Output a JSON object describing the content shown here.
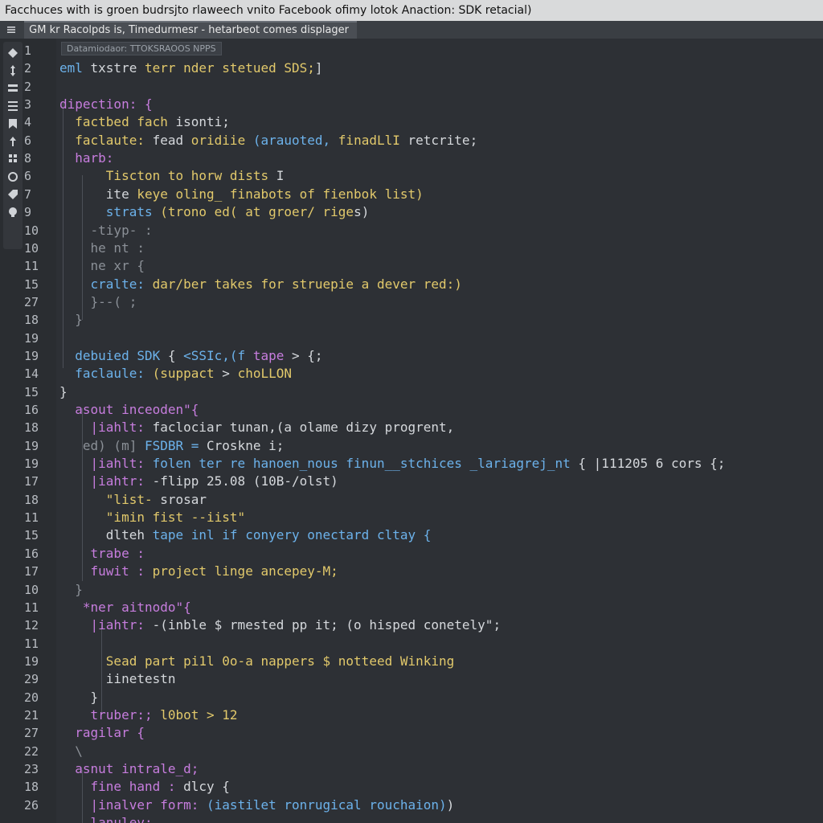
{
  "window": {
    "title": "Facchuces with is groen budrsjto rlaweech vnito Facebook ofimy lotok Anaction: SDK retacial)"
  },
  "tab": {
    "label": "GM kr Racolpds is, Timedurmesr - hetarbeot comes displager"
  },
  "tooltip": {
    "text": "Datamiodaor: TTOKSRAOOS NPPS"
  },
  "sidebar": {
    "tools": [
      "diamond-icon",
      "move-icon",
      "stack-icon",
      "bars-icon",
      "bookmark-icon",
      "arrow-icon",
      "grid-icon",
      "circle-icon",
      "tag-icon",
      "bulb-icon"
    ]
  },
  "colors": {
    "purple": "#c77dde",
    "blue": "#6cb2eb",
    "yellow": "#e2c96b",
    "green": "#b6d77a",
    "white": "#d5d8dc",
    "gray": "#8b9097",
    "background": "#2d3035"
  },
  "gutter": {
    "numbers": [
      "1",
      "2",
      "2",
      "3",
      "4",
      "6",
      "8",
      "6",
      "7",
      "9",
      "10",
      "10",
      "11",
      "15",
      "27",
      "18",
      "19",
      "19",
      "14",
      "15",
      "16",
      "18",
      "19",
      "19",
      "17",
      "18",
      "11",
      "15",
      "16",
      "17",
      "10",
      "11",
      "12",
      "11",
      "19",
      "29",
      "20",
      "21",
      "27",
      "22",
      "23",
      "18",
      "26"
    ]
  },
  "code": {
    "lines": [
      [
        {
          "t": "",
          "c": "white"
        }
      ],
      [
        {
          "t": "eml ",
          "c": "blue"
        },
        {
          "t": "txstre ",
          "c": "white"
        },
        {
          "t": "terr nder stetued SDS;",
          "c": "yellow"
        },
        {
          "t": "]",
          "c": "white"
        }
      ],
      [
        {
          "t": "",
          "c": "white"
        }
      ],
      [
        {
          "t": "dipection: {",
          "c": "purple"
        }
      ],
      [
        {
          "t": "  factbed fach ",
          "c": "yellow"
        },
        {
          "t": "isonti;",
          "c": "white"
        }
      ],
      [
        {
          "t": "  faclaute: ",
          "c": "yellow"
        },
        {
          "t": "fead ",
          "c": "white"
        },
        {
          "t": "oridiie ",
          "c": "yellow"
        },
        {
          "t": "(arauoted, ",
          "c": "blue"
        },
        {
          "t": "finadLlI ",
          "c": "yellow"
        },
        {
          "t": "retcrite;",
          "c": "white"
        }
      ],
      [
        {
          "t": "  harb:",
          "c": "purple"
        }
      ],
      [
        {
          "t": "      Tiscton to horw dists ",
          "c": "yellow"
        },
        {
          "t": "I",
          "c": "white"
        }
      ],
      [
        {
          "t": "      ite ",
          "c": "white"
        },
        {
          "t": "keye oling_ finabots of fienbok list)",
          "c": "yellow"
        }
      ],
      [
        {
          "t": "      strats ",
          "c": "blue"
        },
        {
          "t": "(trono ed( at groer/ rige",
          "c": "yellow"
        },
        {
          "t": "s)",
          "c": "white"
        }
      ],
      [
        {
          "t": "    -tiyp- :",
          "c": "gray"
        }
      ],
      [
        {
          "t": "    he nt :",
          "c": "gray"
        }
      ],
      [
        {
          "t": "    ne xr {",
          "c": "gray"
        }
      ],
      [
        {
          "t": "    cralte: ",
          "c": "blue"
        },
        {
          "t": "dar/ber takes for struepie a dever red:)",
          "c": "yellow"
        }
      ],
      [
        {
          "t": "    }--( ;",
          "c": "gray"
        }
      ],
      [
        {
          "t": "  }",
          "c": "gray"
        }
      ],
      [
        {
          "t": "",
          "c": "white"
        }
      ],
      [
        {
          "t": "  debuied SDK ",
          "c": "blue"
        },
        {
          "t": "{ ",
          "c": "white"
        },
        {
          "t": "<SSIc,(f ",
          "c": "blue"
        },
        {
          "t": "tape ",
          "c": "purple"
        },
        {
          "t": "> {;",
          "c": "white"
        }
      ],
      [
        {
          "t": "  faclaule: ",
          "c": "blue"
        },
        {
          "t": "(suppact ",
          "c": "yellow"
        },
        {
          "t": "> ",
          "c": "white"
        },
        {
          "t": "choLLON",
          "c": "yellow"
        }
      ],
      [
        {
          "t": "}",
          "c": "white"
        }
      ],
      [
        {
          "t": "  asout inceoden\"{",
          "c": "purple"
        }
      ],
      [
        {
          "t": "    |iahlt: ",
          "c": "purple"
        },
        {
          "t": "faclociar tunan,(a olame dizy progrent,",
          "c": "white"
        }
      ],
      [
        {
          "t": "   ed) (m] ",
          "c": "gray"
        },
        {
          "t": "FSDBR = ",
          "c": "blue"
        },
        {
          "t": "Croskne i;",
          "c": "white"
        }
      ],
      [
        {
          "t": "    |iahlt: ",
          "c": "purple"
        },
        {
          "t": "folen ter re hanoen_nous finun__stchices _lariagrej_nt ",
          "c": "blue"
        },
        {
          "t": "{ ",
          "c": "white"
        },
        {
          "t": "|111205 6 cors {;",
          "c": "white"
        }
      ],
      [
        {
          "t": "    |iahtr: ",
          "c": "purple"
        },
        {
          "t": "-flipp 25.08 (10B-/olst)",
          "c": "white"
        }
      ],
      [
        {
          "t": "      \"list- ",
          "c": "yellow"
        },
        {
          "t": "srosar",
          "c": "white"
        }
      ],
      [
        {
          "t": "      \"imin fist --iist\"",
          "c": "yellow"
        }
      ],
      [
        {
          "t": "      dlteh ",
          "c": "white"
        },
        {
          "t": "tape inl if conyery onectard cltay {",
          "c": "blue"
        }
      ],
      [
        {
          "t": "    trabe :",
          "c": "purple"
        }
      ],
      [
        {
          "t": "    fuwit : ",
          "c": "purple"
        },
        {
          "t": "project linge ancepey-M;",
          "c": "yellow"
        }
      ],
      [
        {
          "t": "  }",
          "c": "gray"
        }
      ],
      [
        {
          "t": "   *ner aitnodo\"{",
          "c": "purple"
        }
      ],
      [
        {
          "t": "    |iahtr: ",
          "c": "purple"
        },
        {
          "t": "-(inble $ rmested pp it; (o hisped conetely\";",
          "c": "white"
        }
      ],
      [
        {
          "t": "",
          "c": "white"
        }
      ],
      [
        {
          "t": "      Sead part pi1l 0o-a nappers $ notteed Winking",
          "c": "yellow"
        }
      ],
      [
        {
          "t": "      iinetestn",
          "c": "white"
        }
      ],
      [
        {
          "t": "    }",
          "c": "white"
        }
      ],
      [
        {
          "t": "    truber:; ",
          "c": "purple"
        },
        {
          "t": "l0bot > 12",
          "c": "yellow"
        }
      ],
      [
        {
          "t": "  ragilar {",
          "c": "purple"
        }
      ],
      [
        {
          "t": "  \\",
          "c": "gray"
        }
      ],
      [
        {
          "t": "  asnut intrale_d;",
          "c": "purple"
        }
      ],
      [
        {
          "t": "    fine hand : ",
          "c": "purple"
        },
        {
          "t": "dlcy {",
          "c": "white"
        }
      ],
      [
        {
          "t": "    |inalver form: ",
          "c": "purple"
        },
        {
          "t": "(iastilet ronrugical rouchaion)",
          "c": "blue"
        },
        {
          "t": ")",
          "c": "white"
        }
      ],
      [
        {
          "t": "    lanulev:",
          "c": "purple"
        }
      ]
    ]
  }
}
